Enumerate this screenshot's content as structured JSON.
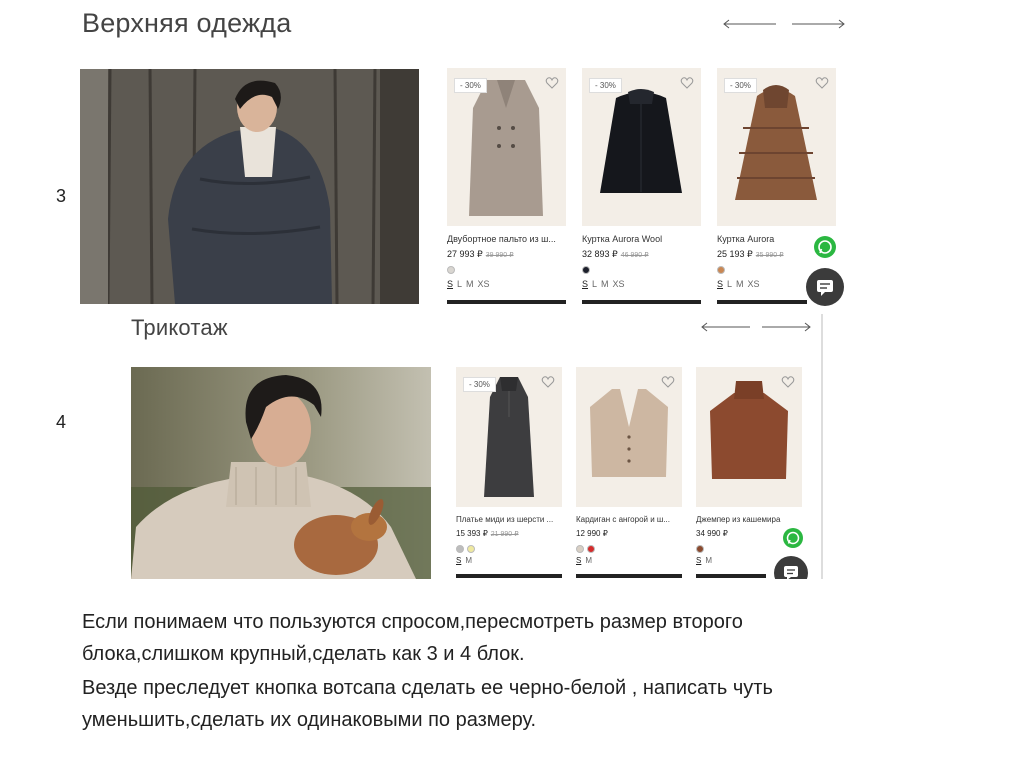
{
  "slide_numbers": {
    "block3": "3",
    "block4": "4"
  },
  "outerwear": {
    "title": "Верхняя одежда",
    "products": [
      {
        "badge": "- 30%",
        "name": "Двубортное пальто из ш...",
        "price": "27 993 ₽",
        "old_price": "39 990 ₽",
        "sizes": [
          "S",
          "L",
          "M",
          "XS"
        ],
        "swatches": [
          "#d9d6d1"
        ]
      },
      {
        "badge": "- 30%",
        "name": "Куртка Aurora Wool",
        "price": "32 893 ₽",
        "old_price": "46 990 ₽",
        "sizes": [
          "S",
          "L",
          "M",
          "S",
          "XS"
        ],
        "swatches": [
          "#1c1f2b"
        ]
      },
      {
        "badge": "- 30%",
        "name": "Куртка Aurora",
        "price": "25 193 ₽",
        "old_price": "35 990 ₽",
        "sizes": [
          "S",
          "L",
          "M",
          "XS"
        ],
        "swatches": [
          "#c98753"
        ]
      }
    ]
  },
  "knitwear": {
    "title": "Трикотаж",
    "products": [
      {
        "badge": "- 30%",
        "name": "Платье миди из шерсти ...",
        "price": "15 393 ₽",
        "old_price": "21 990 ₽",
        "sizes": [
          "S",
          "M"
        ],
        "swatches": [
          "#bdbdbd",
          "#efe9a0"
        ]
      },
      {
        "badge": "",
        "name": "Кардиган с ангорой и ш...",
        "price": "12 990 ₽",
        "old_price": "",
        "sizes": [
          "S",
          "M"
        ],
        "swatches": [
          "#d8cfc4",
          "#d42b2b"
        ]
      },
      {
        "badge": "",
        "name": "Джемпер из кашемира",
        "price": "34 990 ₽",
        "old_price": "",
        "sizes": [
          "S",
          "M"
        ],
        "swatches": [
          "#8a4a2e"
        ]
      }
    ]
  },
  "notes": [
    "Если понимаем что пользуются спросом,пересмотреть размер второго",
    "блока,слишком крупный,сделать как 3 и 4 блок.",
    "Везде преследует кнопка вотсапа сделать ее черно-белой , написать  чуть",
    "уменьшить,сделать их одинаковыми по размеру."
  ],
  "colors": {
    "whatsapp": "#2bb741",
    "chat": "#3b3b3b",
    "card_bg": "#f3eee7",
    "bar": "#222222"
  },
  "icons": [
    "arrow-left-icon",
    "arrow-right-icon",
    "heart-icon",
    "whatsapp-icon",
    "chat-icon"
  ]
}
